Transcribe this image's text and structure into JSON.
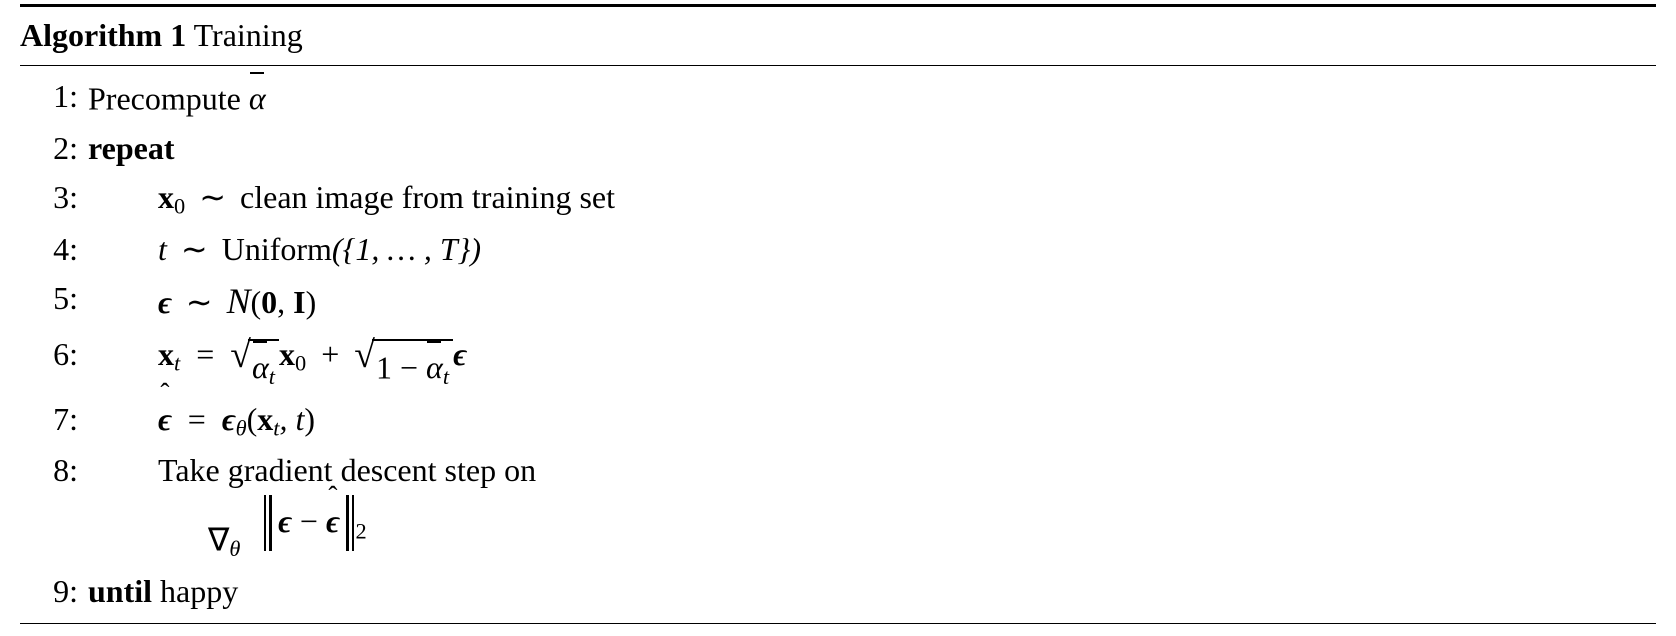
{
  "title_prefix": "Algorithm 1",
  "title_name": "Training",
  "lines": {
    "l1": {
      "n": "1:",
      "txt": "Precompute "
    },
    "l2": {
      "n": "2:",
      "kw": "repeat"
    },
    "l3": {
      "n": "3:",
      "txt": "clean image from training set"
    },
    "l4": {
      "n": "4:"
    },
    "l5": {
      "n": "5:"
    },
    "l6": {
      "n": "6:"
    },
    "l7": {
      "n": "7:"
    },
    "l8": {
      "n": "8:",
      "txt": "Take gradient descent step on"
    },
    "l9": {
      "n": "9:",
      "kw": "until",
      "txt": "happy"
    }
  },
  "math": {
    "alpha": "α",
    "x": "x",
    "zero": "0",
    "t": "t",
    "sim": "∼",
    "uniform": "Uniform",
    "set": "({1, … , T})",
    "eps": "ϵ",
    "N_zero": "0",
    "N_I": "I",
    "eq": "=",
    "plus": "+",
    "one_minus": "1 − ",
    "theta": "θ",
    "comma_t": ", t",
    "nabla": "∇",
    "minus": " − ",
    "sq": "2"
  }
}
